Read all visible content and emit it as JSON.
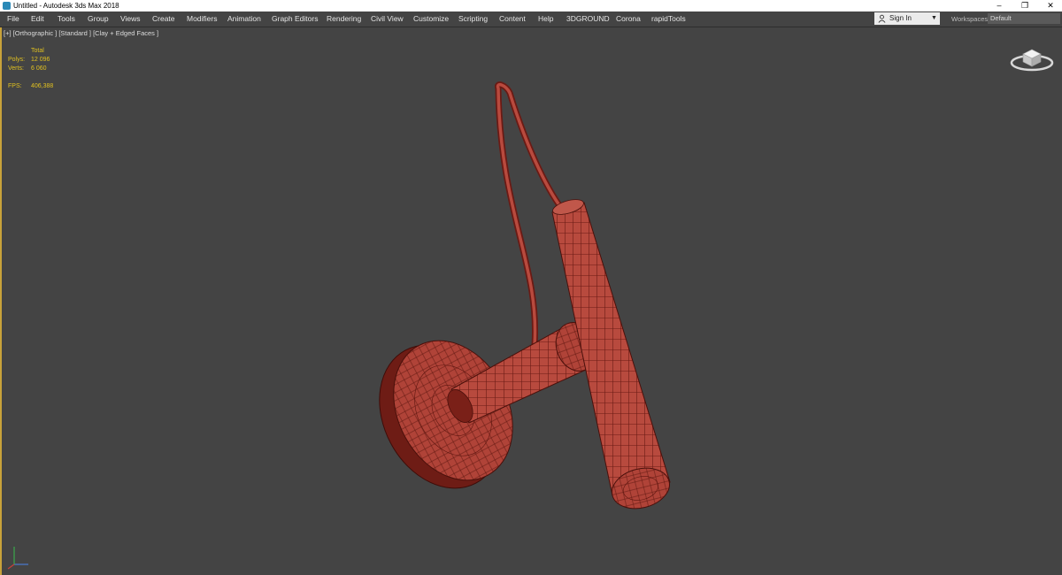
{
  "window": {
    "title": "Untitled - Autodesk 3ds Max 2018",
    "controls": {
      "minimize": "–",
      "maximize": "❐",
      "close": "✕"
    }
  },
  "menu": {
    "items": [
      "File",
      "Edit",
      "Tools",
      "Group",
      "Views",
      "Create",
      "Modifiers",
      "Animation",
      "Graph Editors",
      "Rendering",
      "Civil View",
      "Customize",
      "Scripting",
      "Content",
      "Help",
      "3DGROUND",
      "Corona",
      "rapidTools"
    ],
    "sign_in": "Sign In",
    "workspaces_label": "Workspaces:",
    "workspace_value": "Default"
  },
  "viewport": {
    "label": "[+] [Orthographic ] [Standard ] [Clay + Edged Faces ]",
    "stats": {
      "header": "Total",
      "polys_label": "Polys:",
      "polys_value": "12 096",
      "verts_label": "Verts:",
      "verts_value": "6 060",
      "fps_label": "FPS:",
      "fps_value": "406,388"
    }
  },
  "icons": {
    "app": "3ds-max-icon",
    "user": "user-icon",
    "viewcube": "viewcube-icon",
    "axis": "axis-tripod-icon"
  },
  "colors": {
    "viewport_bg": "#444444",
    "model_fill": "#b84a3e",
    "wire": "#6a1a14",
    "stats_text": "#e0c020",
    "active_border": "#c8a23a"
  }
}
